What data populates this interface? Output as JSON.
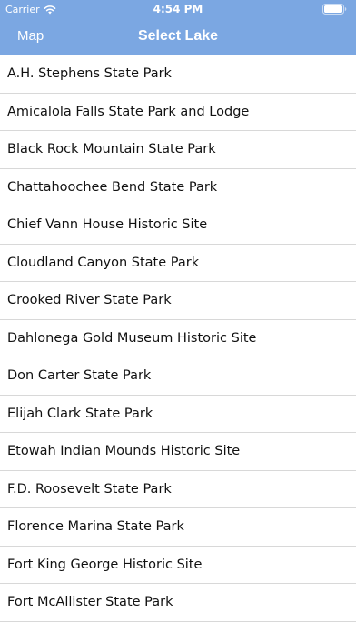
{
  "status_bar": {
    "carrier": "Carrier",
    "time": "4:54 PM",
    "icons": [
      "wifi-icon",
      "battery-icon"
    ]
  },
  "nav": {
    "back_label": "Map",
    "title": "Select Lake"
  },
  "colors": {
    "header_bg": "#7ba7e2",
    "header_text": "#ffffff",
    "separator": "#d8d8d8"
  },
  "items": [
    "A.H. Stephens State Park",
    "Amicalola Falls State Park and Lodge",
    "Black Rock Mountain State Park",
    "Chattahoochee Bend State Park",
    "Chief Vann House Historic Site",
    "Cloudland Canyon State Park",
    "Crooked River State Park",
    "Dahlonega Gold Museum Historic Site",
    "Don Carter State Park",
    "Elijah Clark State Park",
    "Etowah Indian Mounds Historic Site",
    "F.D. Roosevelt State Park",
    "Florence Marina State Park",
    "Fort King George Historic Site",
    "Fort McAllister State Park"
  ]
}
